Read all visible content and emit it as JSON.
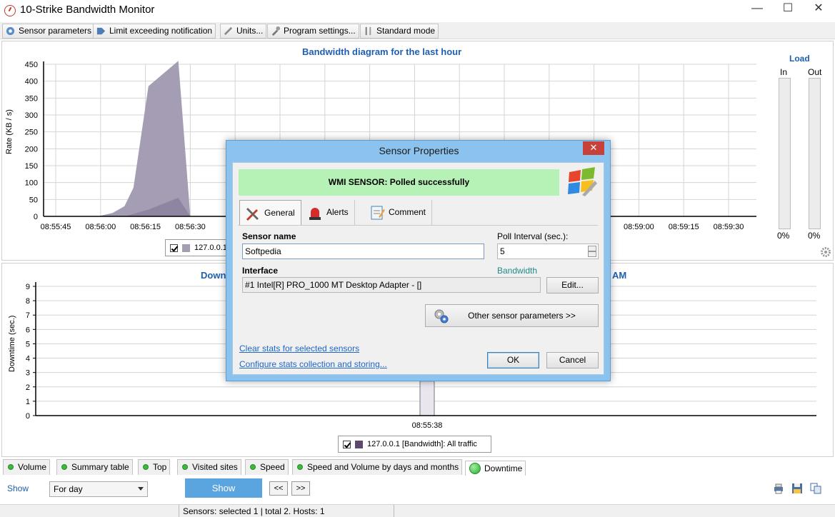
{
  "window": {
    "title": "10-Strike Bandwidth Monitor",
    "minimize": "—",
    "maximize": "☐",
    "close": "✕"
  },
  "toolbar": {
    "sensor_parameters": "Sensor parameters",
    "limit_notification": "Limit exceeding notification",
    "units": "Units...",
    "program_settings": "Program settings...",
    "standard_mode": "Standard mode"
  },
  "chart_data": [
    {
      "type": "area",
      "title": "Bandwidth diagram for the last hour",
      "ylabel": "Rate (KB / s)",
      "xlabel": "",
      "ylim": [
        0,
        450
      ],
      "yticks": [
        "0",
        "50",
        "100",
        "150",
        "200",
        "250",
        "300",
        "350",
        "400",
        "450"
      ],
      "xticks": [
        "08:55:45",
        "08:56:00",
        "08:56:15",
        "08:56:30",
        "08:59:00",
        "08:59:15",
        "08:59:30"
      ],
      "grid": true,
      "series": [
        {
          "name": "127.0.0.1",
          "color": "#a59db4",
          "points": [
            [
              "08:55:59",
              0
            ],
            [
              "08:56:04",
              10
            ],
            [
              "08:56:08",
              30
            ],
            [
              "08:56:11",
              85
            ],
            [
              "08:56:16",
              385
            ],
            [
              "08:56:26",
              460
            ],
            [
              "08:56:30",
              0
            ]
          ]
        },
        {
          "color": "#8e85a1",
          "points": [
            [
              "08:56:08",
              0
            ],
            [
              "08:56:16",
              20
            ],
            [
              "08:56:26",
              55
            ],
            [
              "08:56:30",
              0
            ]
          ]
        }
      ],
      "legend": "bottom"
    },
    {
      "type": "bar",
      "title": "Down",
      "title_right": "AM",
      "ylabel": "Downtime (sec.)",
      "ylim": [
        0,
        9
      ],
      "yticks": [
        "0",
        "1",
        "2",
        "3",
        "4",
        "5",
        "6",
        "7",
        "8",
        "9"
      ],
      "categories": [
        "08:55:38"
      ],
      "grid": true,
      "series": [
        {
          "name": "127.0.0.1 [Bandwidth]: All traffic",
          "values": [
            2.4
          ]
        }
      ],
      "legend": "bottom"
    }
  ],
  "top_legend": {
    "label": "127.0.0.1",
    "color": "#a59db4"
  },
  "bottom_legend": {
    "label": "127.0.0.1 [Bandwidth]: All traffic",
    "color": "#5b4a6e"
  },
  "load": {
    "title": "Load",
    "in_label": "In",
    "out_label": "Out",
    "in_value": "0%",
    "out_value": "0%"
  },
  "tabs": [
    {
      "label": "Volume"
    },
    {
      "label": "Summary table"
    },
    {
      "label": "Top"
    },
    {
      "label": "Visited sites"
    },
    {
      "label": "Speed"
    },
    {
      "label": "Speed and Volume by days and months"
    },
    {
      "label": "Downtime"
    }
  ],
  "controls": {
    "show_label": "Show",
    "period": "For day",
    "show_button": "Show",
    "prev": "<<",
    "next": ">>"
  },
  "status": {
    "sensors": "Sensors: selected 1 | total 2. Hosts: 1"
  },
  "dialog": {
    "title": "Sensor Properties",
    "close": "✕",
    "banner": "WMI SENSOR: Polled successfully",
    "tab_general": "General",
    "tab_alerts": "Alerts",
    "tab_comment": "Comment",
    "sensor_name_label": "Sensor name",
    "sensor_name_value": "Softpedia",
    "poll_label": "Poll Interval (sec.):",
    "poll_value": "5",
    "interface_label": "Interface",
    "bandwidth_label": "Bandwidth",
    "interface_value": "#1 Intel[R] PRO_1000 MT Desktop Adapter - []",
    "edit_button": "Edit...",
    "other_params_button": "Other sensor parameters >>",
    "clear_stats_link": "Clear stats for selected sensors",
    "configure_link": "Configure stats collection and storing...",
    "ok_button": "OK",
    "cancel_button": "Cancel"
  }
}
